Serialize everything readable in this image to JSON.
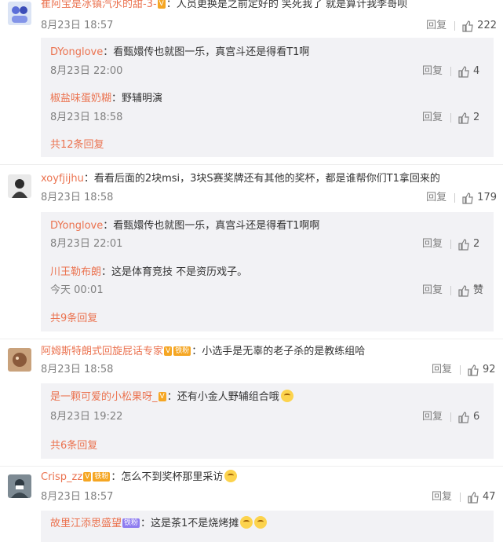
{
  "ui": {
    "reply_label": "回复",
    "like_icon": "thumb-up-icon",
    "accent": "#eb7350",
    "muted": "#808080"
  },
  "comments": [
    {
      "user": "崔阿宝是冰镇汽水的甜-3-",
      "text": "：人员更换是之前定好的  笑死我了  就是算计我李哥呗",
      "time": "8月23日 18:57",
      "likes": "222",
      "replies": [
        {
          "user": "DYonglove",
          "text": "：看甄嬛传也就图一乐，真宫斗还是得看T1啊",
          "time": "8月23日 22:00",
          "likes": "4"
        },
        {
          "user": "椒盐味蛋奶糊",
          "text": "：野辅明演",
          "time": "8月23日 18:58",
          "likes": "2"
        }
      ],
      "more": "共12条回复"
    },
    {
      "user": "xoyfjijhu",
      "text": "：看看后面的2块msi，3块S赛奖牌还有其他的奖杯，都是谁帮你们T1拿回来的",
      "time": "8月23日 18:58",
      "likes": "179",
      "replies": [
        {
          "user": "DYonglove",
          "text": "：看甄嬛传也就图一乐，真宫斗还是得看T1啊啊",
          "time": "8月23日 22:01",
          "likes": "2"
        },
        {
          "user": "川王勒布朗",
          "text": "：这是体育竞技 不是资历戏子。",
          "time": "今天 00:01",
          "likes": "赞"
        }
      ],
      "more": "共9条回复"
    },
    {
      "user": "阿姆斯特朗式回旋屁话专家",
      "text": "：小选手是无辜的老子杀的是教练组哈",
      "time": "8月23日 18:58",
      "likes": "92",
      "replies": [
        {
          "user": "是一颗可爱的小松果呀_",
          "text": "：还有小金人野辅组合哦",
          "time": "8月23日 19:22",
          "likes": "6"
        }
      ],
      "more": "共6条回复"
    },
    {
      "user": "Crisp_zz",
      "text": "：怎么不到奖杯那里采访",
      "time": "8月23日 18:57",
      "likes": "47",
      "replies": [
        {
          "user": "故里江添思盛望",
          "text": "：这是茶1不是烧烤摊"
        }
      ]
    }
  ]
}
